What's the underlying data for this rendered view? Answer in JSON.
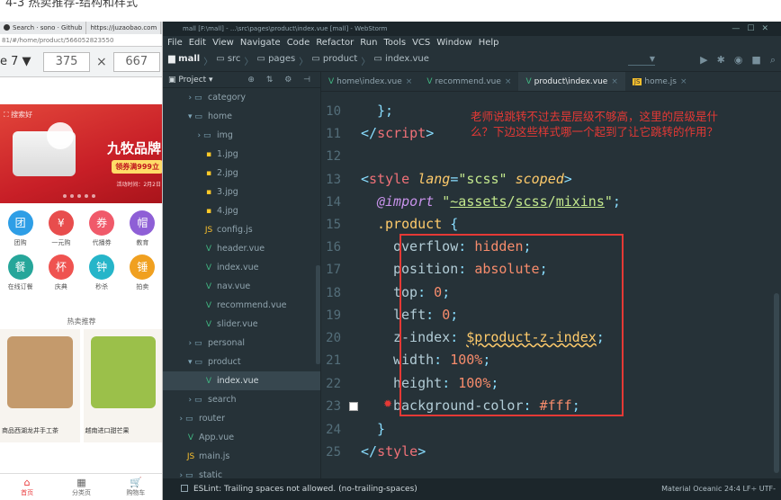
{
  "top_strip": {
    "text": "4-3 热卖推荐-结构和样式"
  },
  "browser": {
    "tabs": [
      "Search · sono · Github",
      "https://juzaobao.com"
    ],
    "url": "81/#/home/product/566052823550",
    "device_name": "e 7 ▼",
    "width": "375",
    "times": "×",
    "height": "667",
    "banner": {
      "search": "搜索好",
      "title": "九牧品牌",
      "promo": "领券满999立",
      "date": "活动时间：2月2日"
    },
    "categories": [
      {
        "label": "团购",
        "glyph": "团",
        "color": "#2e9ee6"
      },
      {
        "label": "一元购",
        "glyph": "¥",
        "color": "#e84d4d"
      },
      {
        "label": "代播券",
        "glyph": "券",
        "color": "#f05a6a"
      },
      {
        "label": "教育",
        "glyph": "帽",
        "color": "#8e5fd6"
      },
      {
        "label": "在线订餐",
        "glyph": "餐",
        "color": "#26a69a"
      },
      {
        "label": "庆典",
        "glyph": "杯",
        "color": "#ef5350"
      },
      {
        "label": "秒杀",
        "glyph": "钟",
        "color": "#26b5c9"
      },
      {
        "label": "拍卖",
        "glyph": "锤",
        "color": "#f0a020"
      }
    ],
    "section_title": "热卖推荐",
    "products": [
      {
        "name": "商品西湖龙井手工茶",
        "img_color": "#c49a6c"
      },
      {
        "name": "越南进口甜芒果",
        "img_color": "#9bc04a"
      }
    ],
    "tabbar": [
      {
        "label": "首页",
        "glyph": "⌂",
        "active": true
      },
      {
        "label": "分类页",
        "glyph": "▦",
        "active": false
      },
      {
        "label": "购物车",
        "glyph": "🛒",
        "active": false
      }
    ]
  },
  "ide": {
    "title": "mall [F:\\mall] - ...\\src\\pages\\product\\index.vue [mall] - WebStorm",
    "menu": [
      "File",
      "Edit",
      "View",
      "Navigate",
      "Code",
      "Refactor",
      "Run",
      "Tools",
      "VCS",
      "Window",
      "Help"
    ],
    "breadcrumb": [
      "mall",
      "src",
      "pages",
      "product",
      "index.vue"
    ],
    "project_header": "Project",
    "tree": [
      {
        "label": "category",
        "type": "folder",
        "indent": 1,
        "open": false
      },
      {
        "label": "home",
        "type": "folder",
        "indent": 1,
        "open": true
      },
      {
        "label": "img",
        "type": "folder",
        "indent": 2,
        "open": false
      },
      {
        "label": "1.jpg",
        "type": "img",
        "indent": 3
      },
      {
        "label": "2.jpg",
        "type": "img",
        "indent": 3
      },
      {
        "label": "3.jpg",
        "type": "img",
        "indent": 3
      },
      {
        "label": "4.jpg",
        "type": "img",
        "indent": 3
      },
      {
        "label": "config.js",
        "type": "js",
        "indent": 3
      },
      {
        "label": "header.vue",
        "type": "vue",
        "indent": 3
      },
      {
        "label": "index.vue",
        "type": "vue",
        "indent": 3
      },
      {
        "label": "nav.vue",
        "type": "vue",
        "indent": 3
      },
      {
        "label": "recommend.vue",
        "type": "vue",
        "indent": 3
      },
      {
        "label": "slider.vue",
        "type": "vue",
        "indent": 3
      },
      {
        "label": "personal",
        "type": "folder",
        "indent": 1,
        "open": false
      },
      {
        "label": "product",
        "type": "folder",
        "indent": 1,
        "open": true
      },
      {
        "label": "index.vue",
        "type": "vue",
        "indent": 3,
        "selected": true
      },
      {
        "label": "search",
        "type": "folder",
        "indent": 1,
        "open": false
      },
      {
        "label": "router",
        "type": "folder",
        "indent": 0,
        "open": false
      },
      {
        "label": "App.vue",
        "type": "vue",
        "indent": 1
      },
      {
        "label": "main.js",
        "type": "js",
        "indent": 1
      },
      {
        "label": "static",
        "type": "folder",
        "indent": 0,
        "open": false
      }
    ],
    "editor_tabs": [
      {
        "label": "home\\index.vue",
        "kind": "vue",
        "active": false
      },
      {
        "label": "recommend.vue",
        "kind": "vue",
        "active": false
      },
      {
        "label": "product\\index.vue",
        "kind": "vue",
        "active": true
      },
      {
        "label": "home.js",
        "kind": "js",
        "active": false
      }
    ],
    "line_numbers": [
      "10",
      "11",
      "12",
      "13",
      "14",
      "15",
      "16",
      "17",
      "18",
      "19",
      "20",
      "21",
      "22",
      "23",
      "24",
      "25"
    ],
    "annotation": "老师说跳转不过去是层级不够高，这里的层级是什么？下边这些样式哪一个起到了让它跳转的作用？",
    "bottom_crumb": "style",
    "status_text": "ESLint: Trailing spaces not allowed. (no-trailing-spaces)",
    "status_right": "Material Oceanic    24:4    LF÷    UTF-"
  },
  "colors": {
    "ide_bg": "#263238",
    "annotation": "#e53935",
    "tab_active_red": "#e93b3d"
  }
}
